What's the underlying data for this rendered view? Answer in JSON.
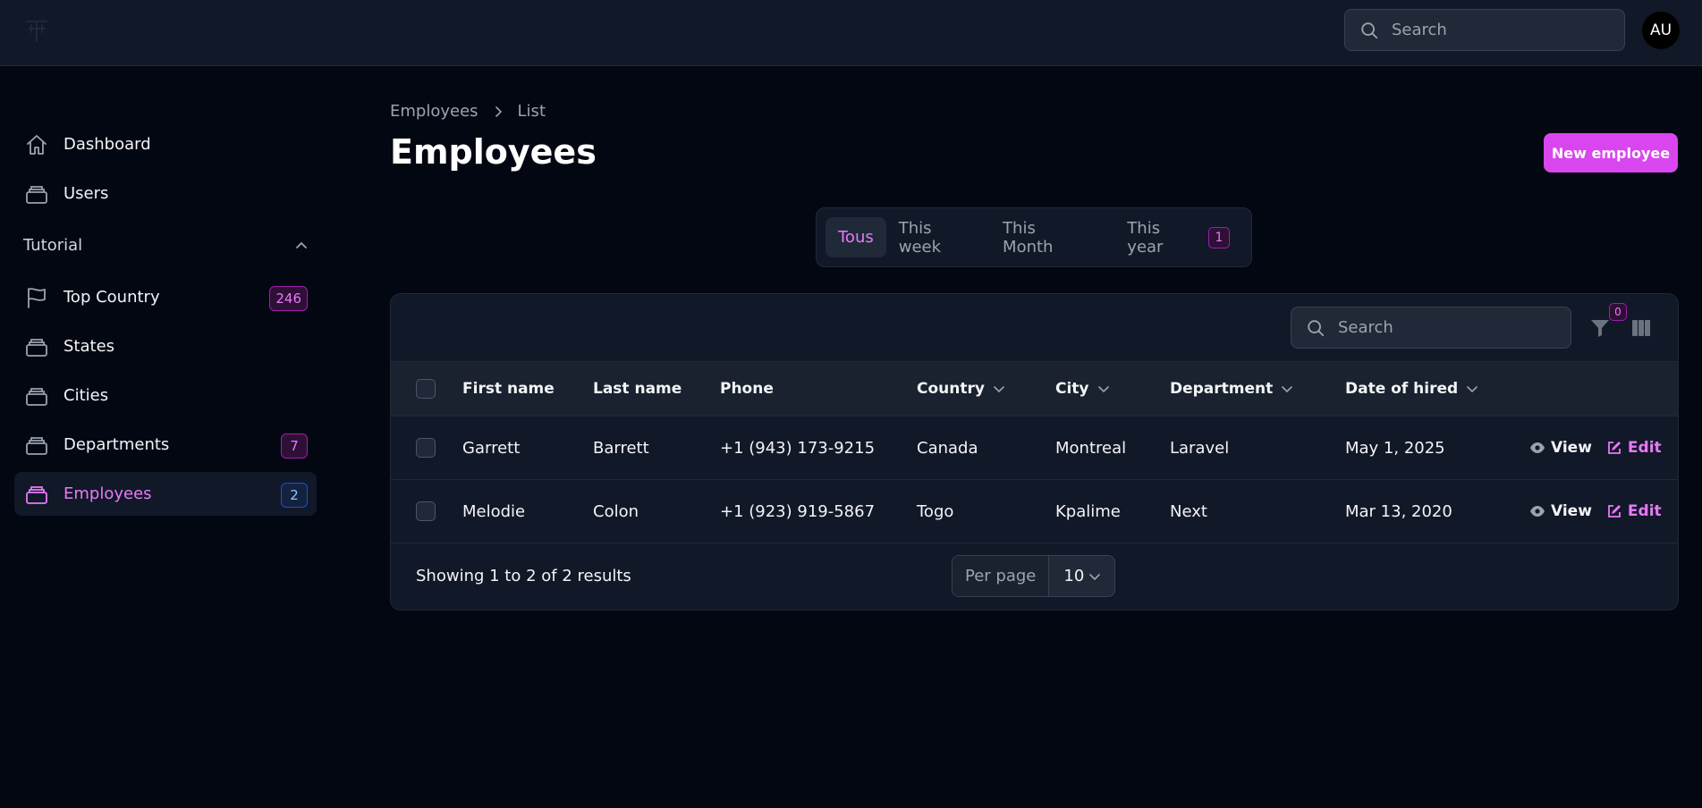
{
  "topbar": {
    "search_placeholder": "Search",
    "avatar_initials": "AU"
  },
  "sidebar": {
    "items_top": [
      {
        "label": "Dashboard",
        "icon": "home-icon"
      },
      {
        "label": "Users",
        "icon": "stack-icon"
      }
    ],
    "group": {
      "label": "Tutorial",
      "expanded": true
    },
    "items_group": [
      {
        "label": "Top Country",
        "icon": "flag-icon",
        "badge": "246"
      },
      {
        "label": "States",
        "icon": "stack-icon"
      },
      {
        "label": "Cities",
        "icon": "stack-icon"
      },
      {
        "label": "Departments",
        "icon": "stack-icon",
        "badge": "7"
      },
      {
        "label": "Employees",
        "icon": "stack-icon",
        "badge": "2",
        "active": true
      }
    ]
  },
  "header": {
    "breadcrumb": [
      "Employees",
      "List"
    ],
    "title": "Employees",
    "new_button": "New employee"
  },
  "tabs": [
    {
      "label": "Tous",
      "active": true
    },
    {
      "label": "This week"
    },
    {
      "label": "This Month"
    },
    {
      "label": "This year",
      "badge": "1"
    }
  ],
  "table": {
    "search_placeholder": "Search",
    "filter_count": "0",
    "columns": [
      "First name",
      "Last name",
      "Phone",
      "Country",
      "City",
      "Department",
      "Date of hired"
    ],
    "rows": [
      {
        "first_name": "Garrett",
        "last_name": "Barrett",
        "phone": "+1 (943) 173-9215",
        "country": "Canada",
        "city": "Montreal",
        "department": "Laravel",
        "date_hired": "May 1, 2025"
      },
      {
        "first_name": "Melodie",
        "last_name": "Colon",
        "phone": "+1 (923) 919-5867",
        "country": "Togo",
        "city": "Kpalime",
        "department": "Next",
        "date_hired": "Mar 13, 2020"
      }
    ],
    "row_actions": {
      "view": "View",
      "edit": "Edit"
    },
    "summary": "Showing 1 to 2 of 2 results",
    "per_page_label": "Per page",
    "per_page_value": "10"
  },
  "colors": {
    "accent": "#d946ef",
    "accent_text": "#e879f9",
    "background": "#030712",
    "surface": "#111827"
  }
}
